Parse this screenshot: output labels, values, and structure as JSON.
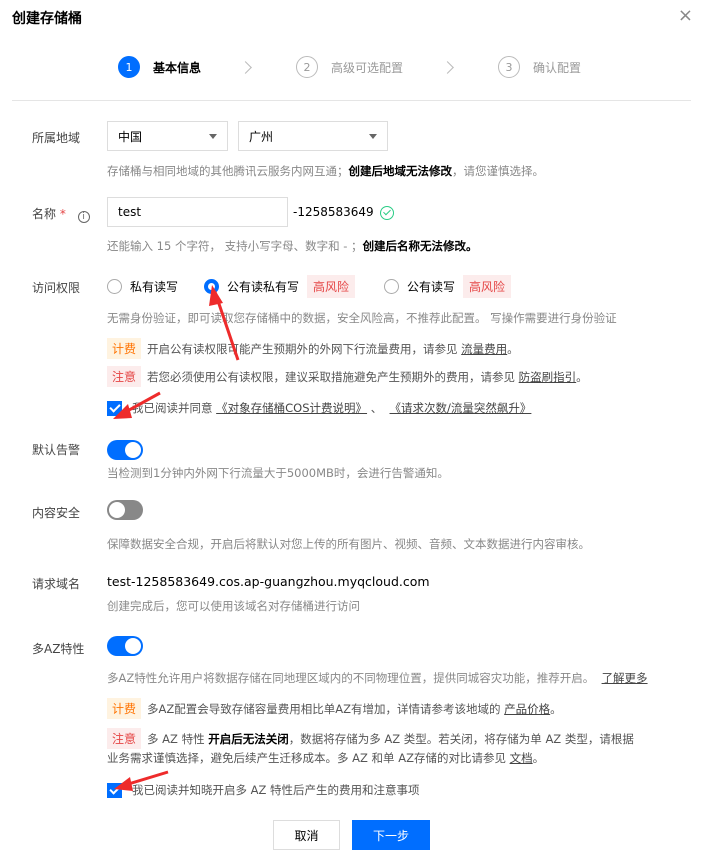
{
  "dialog": {
    "title": "创建存储桶",
    "close": "×"
  },
  "steps": [
    {
      "num": "1",
      "label": "基本信息"
    },
    {
      "num": "2",
      "label": "高级可选配置"
    },
    {
      "num": "3",
      "label": "确认配置"
    }
  ],
  "region": {
    "label": "所属地域",
    "country": "中国",
    "city": "广州",
    "hint_pre": "存储桶与相同地域的其他腾讯云服务内网互通；",
    "hint_bold": "创建后地域无法修改",
    "hint_post": "，请您谨慎选择。"
  },
  "name": {
    "label": "名称",
    "required_mark": "*",
    "info_icon": "i",
    "value": "test",
    "suffix": "-1258583649",
    "hint_pre": "还能输入 15 个字符，  支持小写字母、数字和 - ；",
    "hint_bold": "创建后名称无法修改。"
  },
  "access": {
    "label": "访问权限",
    "options": [
      {
        "label": "私有读写"
      },
      {
        "label": "公有读私有写",
        "risk": "高风险"
      },
      {
        "label": "公有读写",
        "risk": "高风险"
      }
    ],
    "desc": "无需身份验证，即可读取您存储桶中的数据，安全风险高，不推荐此配置。  写操作需要进行身份验证",
    "fee_tag": "计费",
    "fee_text": "开启公有读权限可能产生预期外的外网下行流量费用，请参见",
    "fee_link": "流量费用",
    "fee_end": "。",
    "warn_tag": "注意",
    "warn_text": "若您必须使用公有读权限，建议采取措施避免产生预期外的费用，请参见",
    "warn_link": "防盗刷指引",
    "warn_end": "。",
    "agree_text": "我已阅读并同意",
    "agree_link1": "《对象存储桶COS计费说明》",
    "agree_sep": "、",
    "agree_link2": "《请求次数/流量突然飙升》"
  },
  "alarm": {
    "label": "默认告警",
    "hint": "当检测到1分钟内外网下行流量大于5000MB时，会进行告警通知。"
  },
  "content_security": {
    "label": "内容安全",
    "hint": "保障数据安全合规，开启后将默认对您上传的所有图片、视频、音频、文本数据进行内容审核。"
  },
  "domain": {
    "label": "请求域名",
    "value": "test-1258583649.cos.ap-guangzhou.myqcloud.com",
    "hint": "创建完成后，您可以使用该域名对存储桶进行访问"
  },
  "multi_az": {
    "label": "多AZ特性",
    "desc": "多AZ特性允许用户将数据存储在同地理区域内的不同物理位置，提供同城容灾功能，推荐开启。",
    "desc_link": "了解更多",
    "fee_tag": "计费",
    "fee_text": "多AZ配置会导致存储容量费用相比单AZ有增加，详情请参考该地域的",
    "fee_link": "产品价格",
    "fee_end": "。",
    "warn_tag": "注意",
    "warn_pre": "多 AZ 特性",
    "warn_bold": "开启后无法关闭",
    "warn_post": "，数据将存储为多 AZ 类型。若关闭，将存储为单 AZ 类型，请根据",
    "warn_line2": "业务需求谨慎选择，避免后续产生迁移成本。多 AZ 和单 AZ存储的对比请参见",
    "warn_link": "文档",
    "warn_end": "。",
    "agree_text": "我已阅读并知晓开启多 AZ 特性后产生的费用和注意事项"
  },
  "footer": {
    "cancel": "取消",
    "next": "下一步"
  },
  "colors": {
    "primary": "#006eff",
    "danger": "#e54545",
    "fee": "#ff7200",
    "success": "#29cc85",
    "annotation": "#ee2b2b"
  }
}
